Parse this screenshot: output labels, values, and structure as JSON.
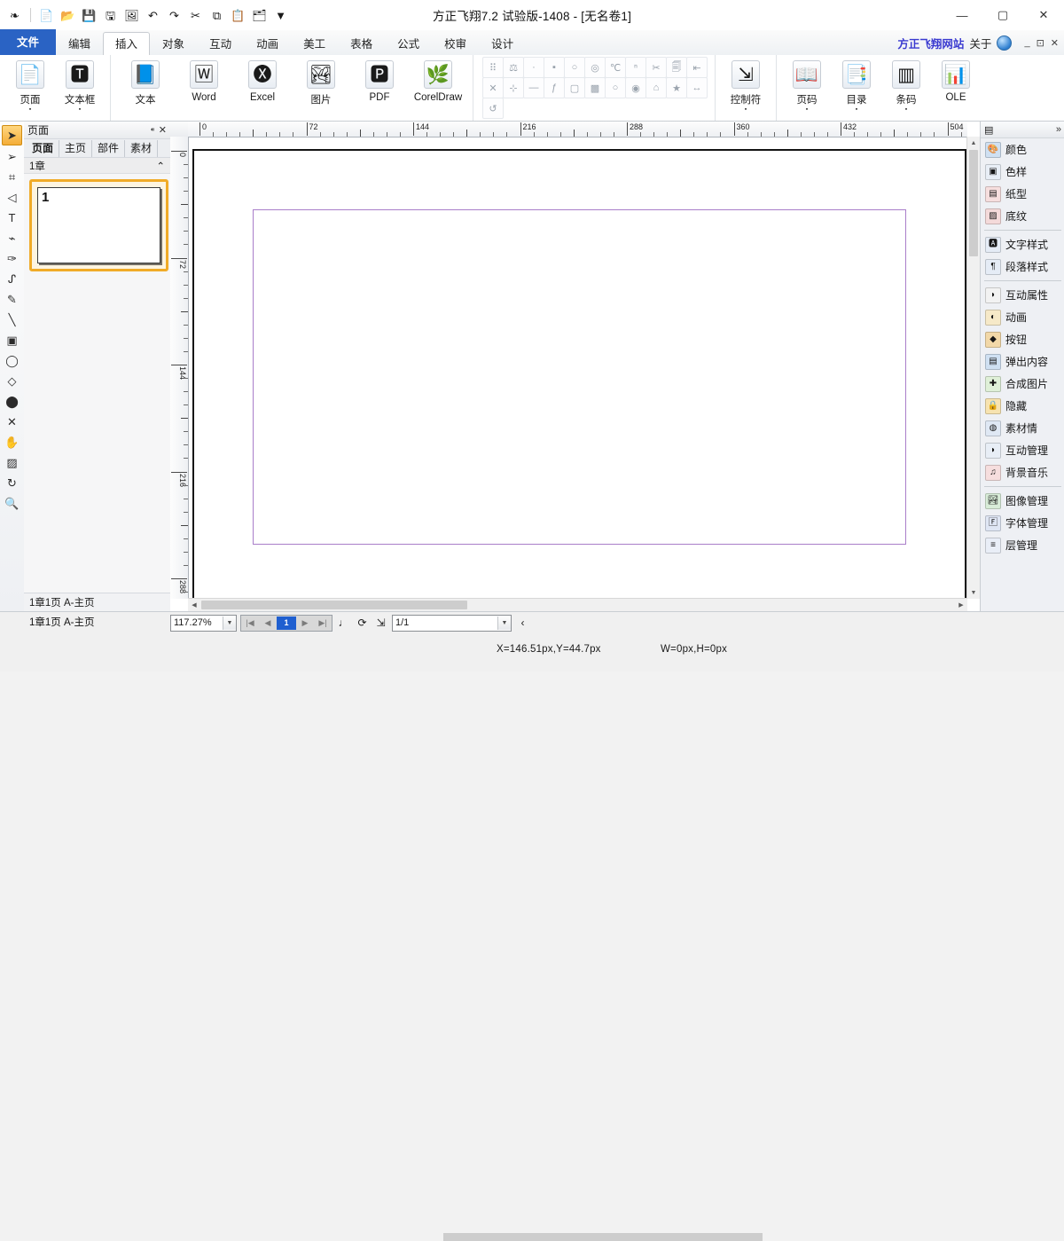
{
  "window": {
    "title": "方正飞翔7.2 试验版-1408 - [无名卷1]",
    "minimize": "—",
    "maximize": "▢",
    "close": "✕"
  },
  "quick_access": [
    {
      "name": "app-logo-icon",
      "glyph": "❧"
    },
    {
      "name": "new-document-icon",
      "glyph": "📄"
    },
    {
      "name": "open-folder-icon",
      "glyph": "📂"
    },
    {
      "name": "save-icon",
      "glyph": "💾"
    },
    {
      "name": "export-icon",
      "glyph": "🖫"
    },
    {
      "name": "preview-icon",
      "glyph": "🖼"
    },
    {
      "name": "undo-icon",
      "glyph": "↶"
    },
    {
      "name": "redo-icon",
      "glyph": "↷"
    },
    {
      "name": "cut-icon",
      "glyph": "✂"
    },
    {
      "name": "copy-icon",
      "glyph": "⧉"
    },
    {
      "name": "paste-icon",
      "glyph": "📋"
    },
    {
      "name": "publish-icon",
      "glyph": "🗂"
    },
    {
      "name": "customize-dropdown-icon",
      "glyph": "▼"
    }
  ],
  "tabs": [
    {
      "label": "文件",
      "kind": "file"
    },
    {
      "label": "编辑",
      "kind": "normal"
    },
    {
      "label": "插入",
      "kind": "active"
    },
    {
      "label": "对象",
      "kind": "normal"
    },
    {
      "label": "互动",
      "kind": "normal"
    },
    {
      "label": "动画",
      "kind": "normal"
    },
    {
      "label": "美工",
      "kind": "normal"
    },
    {
      "label": "表格",
      "kind": "normal"
    },
    {
      "label": "公式",
      "kind": "normal"
    },
    {
      "label": "校审",
      "kind": "normal"
    },
    {
      "label": "设计",
      "kind": "normal"
    }
  ],
  "ribbon_right": {
    "site_link": "方正飞翔网站",
    "about_link": "关于",
    "help_icon": "help-icon",
    "minimize": "_",
    "restore": "⊡",
    "close": "✕"
  },
  "ribbon": {
    "group1": [
      {
        "label": "页面",
        "icon": "page-icon",
        "glyph": "📄",
        "dropdown": "▪"
      },
      {
        "label": "文本框",
        "icon": "textbox-icon",
        "glyph": "🆃",
        "dropdown": "▪"
      }
    ],
    "group2": [
      {
        "label": "文本",
        "icon": "text-icon",
        "glyph": "📘",
        "dropdown": ""
      },
      {
        "label": "Word",
        "icon": "word-icon",
        "glyph": "🅆",
        "dropdown": ""
      },
      {
        "label": "Excel",
        "icon": "excel-icon",
        "glyph": "🅧",
        "dropdown": ""
      },
      {
        "label": "图片",
        "icon": "image-icon",
        "glyph": "🏞",
        "dropdown": ""
      },
      {
        "label": "PDF",
        "icon": "pdf-icon",
        "glyph": "🅿",
        "dropdown": ""
      },
      {
        "label": "CorelDraw",
        "icon": "coreldraw-icon",
        "glyph": "🌿",
        "dropdown": ""
      }
    ],
    "small_icons_row1": [
      "⠿",
      "⚖",
      "·",
      "▪",
      "○",
      "◎",
      "℃",
      "ⁿ",
      "✂",
      "🗐",
      "⇤"
    ],
    "small_icons_row2": [
      "✕",
      "⊹",
      "—",
      "ƒ",
      "▢",
      "▩",
      "○",
      "◉",
      "⌂",
      "★",
      "↔",
      "↺"
    ],
    "group4": [
      {
        "label": "控制符",
        "icon": "control-character-icon",
        "glyph": "⇲",
        "dropdown": "▪"
      }
    ],
    "group5": [
      {
        "label": "页码",
        "icon": "page-number-icon",
        "glyph": "📖",
        "dropdown": "▪"
      },
      {
        "label": "目录",
        "icon": "toc-icon",
        "glyph": "📑",
        "dropdown": "▪"
      },
      {
        "label": "条码",
        "icon": "barcode-icon",
        "glyph": "▥",
        "dropdown": "▪"
      },
      {
        "label": "OLE",
        "icon": "ole-icon",
        "glyph": "📊",
        "dropdown": ""
      }
    ]
  },
  "toolbox": [
    {
      "name": "selection-tool",
      "glyph": "➤",
      "active": true
    },
    {
      "name": "direct-selection-tool",
      "glyph": "➢",
      "active": false
    },
    {
      "name": "crop-tool",
      "glyph": "⌗",
      "active": false
    },
    {
      "name": "polygon-tool",
      "glyph": "◁",
      "active": false
    },
    {
      "name": "text-tool",
      "glyph": "T",
      "active": false
    },
    {
      "name": "path-tool",
      "glyph": "⌁",
      "active": false
    },
    {
      "name": "pen-tool",
      "glyph": "✑",
      "active": false
    },
    {
      "name": "curve-tool",
      "glyph": "ᔑ",
      "active": false
    },
    {
      "name": "brush-tool",
      "glyph": "✎",
      "active": false
    },
    {
      "name": "line-tool",
      "glyph": "╲",
      "active": false
    },
    {
      "name": "rectangle-frame-tool",
      "glyph": "▣",
      "active": false
    },
    {
      "name": "ellipse-tool",
      "glyph": "◯",
      "active": false
    },
    {
      "name": "diamond-tool",
      "glyph": "◇",
      "active": false
    },
    {
      "name": "circle-tool",
      "glyph": "⬤",
      "active": false
    },
    {
      "name": "scissors-tool",
      "glyph": "✕",
      "active": false
    },
    {
      "name": "hand-tool",
      "glyph": "✋",
      "active": false
    },
    {
      "name": "gradient-tool",
      "glyph": "▨",
      "active": false
    },
    {
      "name": "rotate-tool",
      "glyph": "↻",
      "active": false
    },
    {
      "name": "zoom-tool",
      "glyph": "🔍",
      "active": false
    }
  ],
  "page_panel": {
    "title": "页面",
    "pin_icon": "⁌",
    "close_icon": "✕",
    "tabs": [
      "页面",
      "主页",
      "部件",
      "素材"
    ],
    "active_tab": "页面",
    "chapter_label": "1章",
    "collapse_icon": "⌃",
    "thumbnail_number": "1",
    "footer": "1章1页  A-主页"
  },
  "canvas": {
    "ruler_h_labels": [
      "0",
      "72",
      "144",
      "216",
      "288",
      "360",
      "432",
      "504"
    ],
    "ruler_v_labels": [
      "0",
      "72",
      "144",
      "216",
      "288"
    ],
    "margin_guide_color": "#a97ec9",
    "page_border_color": "#141414"
  },
  "right_panel": {
    "header_icon": "panel-icon",
    "expand_icon": "»",
    "groups": [
      [
        {
          "label": "颜色",
          "icon": "color-icon",
          "glyph": "🎨",
          "bg": "#cfe0f2"
        },
        {
          "label": "色样",
          "icon": "swatch-icon",
          "glyph": "▣",
          "bg": "#e8eef6"
        },
        {
          "label": "纸型",
          "icon": "paper-type-icon",
          "glyph": "▤",
          "bg": "#f6dede"
        },
        {
          "label": "底纹",
          "icon": "shading-icon",
          "glyph": "▨",
          "bg": "#f4dada"
        }
      ],
      [
        {
          "label": "文字样式",
          "icon": "character-style-icon",
          "glyph": "🅰",
          "bg": "#e5ecf6"
        },
        {
          "label": "段落样式",
          "icon": "paragraph-style-icon",
          "glyph": "¶",
          "bg": "#e5ecf6"
        }
      ],
      [
        {
          "label": "互动属性",
          "icon": "interaction-property-icon",
          "glyph": "◗",
          "bg": "#f2f2f2"
        },
        {
          "label": "动画",
          "icon": "animation-icon",
          "glyph": "◐",
          "bg": "#f6e9c8"
        },
        {
          "label": "按钮",
          "icon": "button-icon",
          "glyph": "◆",
          "bg": "#f2d8a8"
        },
        {
          "label": "弹出内容",
          "icon": "popup-content-icon",
          "glyph": "▤",
          "bg": "#cfe0f2"
        },
        {
          "label": "合成图片",
          "icon": "composite-image-icon",
          "glyph": "✚",
          "bg": "#dff0d8"
        },
        {
          "label": "隐藏",
          "icon": "hide-icon",
          "glyph": "🔒",
          "bg": "#f7e3b0"
        },
        {
          "label": "素材情",
          "icon": "material-icon",
          "glyph": "◍",
          "bg": "#dfe8f4"
        },
        {
          "label": "互动管理",
          "icon": "interaction-manager-icon",
          "glyph": "◗",
          "bg": "#e8eef6"
        },
        {
          "label": "背景音乐",
          "icon": "background-music-icon",
          "glyph": "♫",
          "bg": "#f6dede"
        }
      ],
      [
        {
          "label": "图像管理",
          "icon": "image-manager-icon",
          "glyph": "🏞",
          "bg": "#d8ecd8"
        },
        {
          "label": "字体管理",
          "icon": "font-manager-icon",
          "glyph": "🄵",
          "bg": "#dfe6f4"
        },
        {
          "label": "层管理",
          "icon": "layer-manager-icon",
          "glyph": "≡",
          "bg": "#e9eef7"
        }
      ]
    ]
  },
  "status_bar": {
    "zoom_value": "117.27%",
    "nav_cells": [
      "|◀",
      "◀",
      "1",
      "▶",
      "▶|"
    ],
    "current_nav_index": 2,
    "page_indicator": "1/1",
    "icons": [
      "♩",
      "⟳",
      "⇲"
    ],
    "prev_chevron": "‹",
    "coords": "X=146.51px,Y=44.7px",
    "dims": "W=0px,H=0px"
  }
}
